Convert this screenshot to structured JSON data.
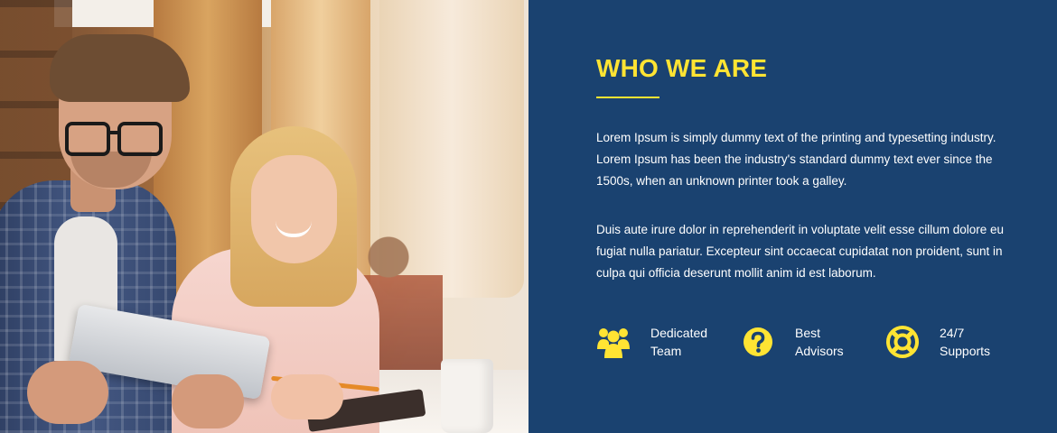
{
  "photo": {
    "alt_description": ""
  },
  "section": {
    "title": "WHO WE ARE",
    "paragraph_1": "Lorem Ipsum is simply dummy text of the printing and typesetting industry. Lorem Ipsum has been the industry's standard dummy text ever since the 1500s, when an unknown printer took a galley.",
    "paragraph_2": "Duis aute irure dolor in reprehenderit in voluptate velit esse cillum dolore eu fugiat nulla pariatur. Excepteur sint occaecat cupidatat non proident, sunt in culpa qui officia deserunt mollit anim id est laborum."
  },
  "features": [
    {
      "icon": "team-icon",
      "line1": "Dedicated",
      "line2": "Team"
    },
    {
      "icon": "question-icon",
      "line1": "Best",
      "line2": "Advisors"
    },
    {
      "icon": "lifebuoy-icon",
      "line1": "24/7",
      "line2": "Supports"
    }
  ],
  "colors": {
    "panel_bg": "#1a4270",
    "accent": "#ffe433",
    "text": "#ffffff"
  }
}
